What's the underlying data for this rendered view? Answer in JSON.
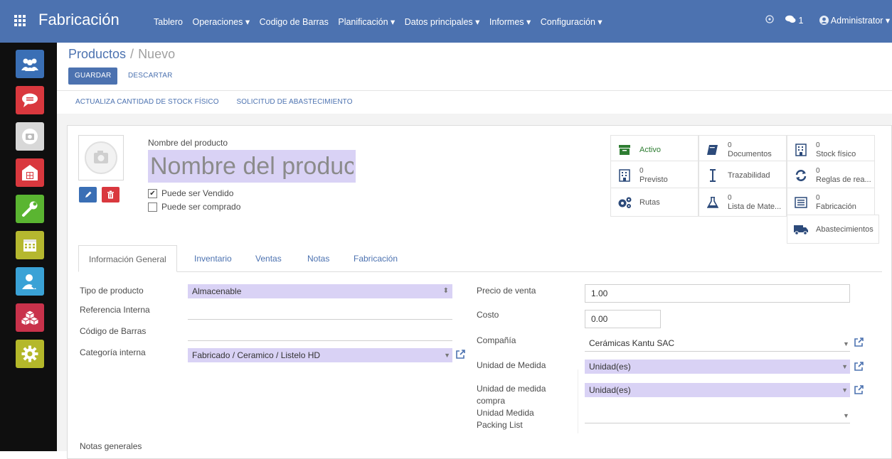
{
  "app": {
    "title": "Fabricación",
    "menu": [
      "Tablero",
      "Operaciones ▾",
      "Codigo de Barras",
      "Planificación ▾",
      "Datos principales ▾",
      "Informes ▾",
      "Configuración ▾"
    ],
    "messages_count": "1",
    "user": "Administrator ▾"
  },
  "sidebar": {
    "items": [
      {
        "icon": "users-icon",
        "color": "#3a6fb5"
      },
      {
        "icon": "chat-icon",
        "color": "#d9383e"
      },
      {
        "icon": "camera-icon",
        "color": "#d8d8d8"
      },
      {
        "icon": "warehouse-icon",
        "color": "#d9383e"
      },
      {
        "icon": "wrench-icon",
        "color": "#5ab531"
      },
      {
        "icon": "calendar-icon",
        "color": "#b5b82f"
      },
      {
        "icon": "user-check-icon",
        "color": "#3aa2d6"
      },
      {
        "icon": "cubes-icon",
        "color": "#c9324b"
      },
      {
        "icon": "gear-icon",
        "color": "#b4b82a"
      }
    ]
  },
  "breadcrumb": {
    "parent": "Productos",
    "separator": "/",
    "current": "Nuevo"
  },
  "buttons": {
    "save": "GUARDAR",
    "discard": "DESCARTAR"
  },
  "actions": [
    "ACTUALIZA CANTIDAD DE STOCK FÍSICO",
    "SOLICITUD DE ABASTECIMIENTO"
  ],
  "product": {
    "name_label": "Nombre del producto",
    "name_placeholder": "Nombre del producto",
    "can_sell_label": "Puede ser Vendido",
    "can_sell": true,
    "can_buy_label": "Puede ser comprado",
    "can_buy": false
  },
  "smart_buttons": {
    "activo": {
      "label": "Activo",
      "icon": "archive-icon"
    },
    "documentos": {
      "count": "0",
      "label": "Documentos",
      "icon": "book-icon"
    },
    "stock": {
      "count": "0",
      "label": "Stock físico",
      "icon": "building-icon"
    },
    "previsto": {
      "count": "0",
      "label": "Previsto",
      "icon": "building-icon"
    },
    "trazabilidad": {
      "label": "Trazabilidad",
      "icon": "arrows-vertical-icon"
    },
    "reglas": {
      "count": "0",
      "label": "Reglas de rea...",
      "icon": "refresh-icon"
    },
    "rutas": {
      "label": "Rutas",
      "icon": "cogs-icon"
    },
    "lista": {
      "count": "0",
      "label": "Lista de Mate...",
      "icon": "flask-icon"
    },
    "fabricacion": {
      "count": "0",
      "label": "Fabricación",
      "icon": "list-icon"
    },
    "abastecimientos": {
      "label": "Abastecimientos",
      "icon": "truck-icon"
    }
  },
  "tabs": [
    "Información General",
    "Inventario",
    "Ventas",
    "Notas",
    "Fabricación"
  ],
  "left_fields": {
    "tipo_label": "Tipo de producto",
    "tipo_value": "Almacenable",
    "ref_label": "Referencia Interna",
    "barcode_label": "Código de Barras",
    "categoria_label": "Categoría interna",
    "categoria_value": "Fabricado / Ceramico / Listelo HD"
  },
  "right_fields": {
    "precio_label": "Precio de venta",
    "precio_value": "1.00",
    "costo_label": "Costo",
    "costo_value": "0.00",
    "compania_label": "Compañía",
    "compania_value": "Cerámicas Kantu SAC",
    "udm_label": "Unidad de Medida",
    "udm_value": "Unidad(es)",
    "udm_compra_label_1": "Unidad de medida",
    "udm_compra_label_2": "compra",
    "udm_compra_value": "Unidad(es)",
    "udm_packing_label_1": "Unidad Medida",
    "udm_packing_label_2": "Packing List"
  },
  "notes_label": "Notas generales"
}
